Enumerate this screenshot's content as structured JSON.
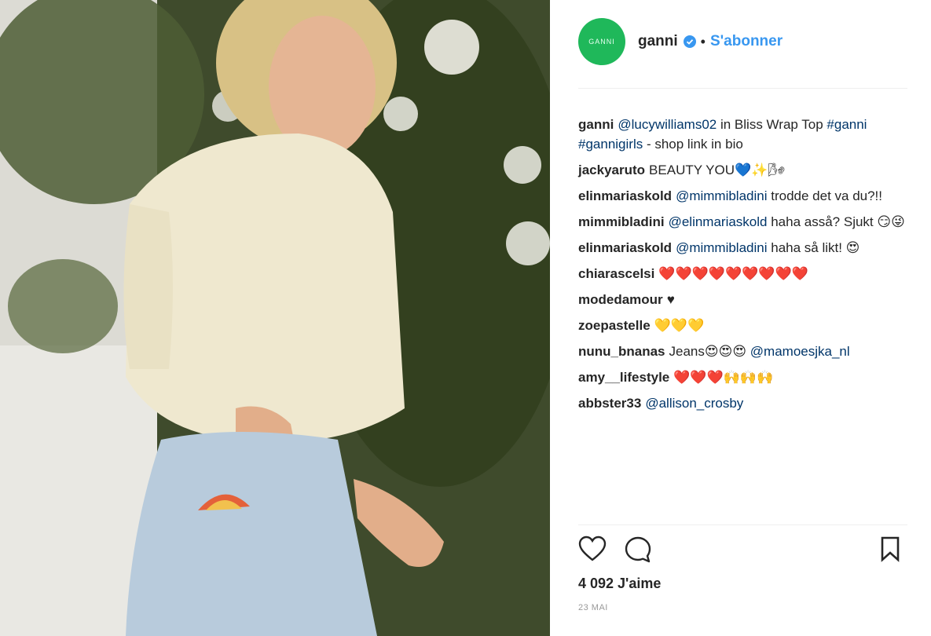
{
  "photo": {
    "description_icon": "post-photo"
  },
  "header": {
    "avatar_text": "GANNI",
    "username": "ganni",
    "separator": "•",
    "follow_label": "S'abonner"
  },
  "comments": [
    {
      "user": "ganni",
      "parts": [
        {
          "t": "mention",
          "v": "@lucywilliams02"
        },
        {
          "t": "text",
          "v": " in Bliss Wrap Top "
        },
        {
          "t": "mention",
          "v": "#ganni"
        },
        {
          "t": "text",
          "v": " "
        },
        {
          "t": "mention",
          "v": "#gannigirls"
        },
        {
          "t": "text",
          "v": " - shop link in bio"
        }
      ]
    },
    {
      "user": "jackyaruto",
      "parts": [
        {
          "t": "text",
          "v": "BEAUTY YOU💙✨🌬"
        }
      ]
    },
    {
      "user": "elinmariaskold",
      "parts": [
        {
          "t": "mention",
          "v": "@mimmibladini"
        },
        {
          "t": "text",
          "v": " trodde det va du?!!"
        }
      ]
    },
    {
      "user": "mimmibladini",
      "parts": [
        {
          "t": "mention",
          "v": "@elinmariaskold"
        },
        {
          "t": "text",
          "v": " haha asså? Sjukt 😏😜"
        }
      ]
    },
    {
      "user": "elinmariaskold",
      "parts": [
        {
          "t": "mention",
          "v": "@mimmibladini"
        },
        {
          "t": "text",
          "v": " haha så likt! 😍"
        }
      ]
    },
    {
      "user": "chiarascelsi",
      "parts": [
        {
          "t": "text",
          "v": "❤️❤️❤️❤️❤️❤️❤️❤️❤️"
        }
      ]
    },
    {
      "user": "modedamour",
      "parts": [
        {
          "t": "text",
          "v": "♥"
        }
      ]
    },
    {
      "user": "zoepastelle",
      "parts": [
        {
          "t": "text",
          "v": "💛💛💛"
        }
      ]
    },
    {
      "user": "nunu_bnanas",
      "parts": [
        {
          "t": "text",
          "v": "Jeans😍😍😍 "
        },
        {
          "t": "mention",
          "v": "@mamoesjka_nl"
        }
      ]
    },
    {
      "user": "amy__lifestyle",
      "parts": [
        {
          "t": "text",
          "v": "❤️❤️❤️🙌🙌🙌"
        }
      ]
    },
    {
      "user": "abbster33",
      "parts": [
        {
          "t": "mention",
          "v": "@allison_crosby"
        }
      ]
    }
  ],
  "actions": {
    "like_icon": "heart-icon",
    "comment_icon": "comment-icon",
    "save_icon": "bookmark-icon"
  },
  "likes_text": "4 092 J'aime",
  "date_text": "23 MAI",
  "colors": {
    "link": "#3897f0",
    "mention": "#003569",
    "avatar": "#1fb85a"
  }
}
